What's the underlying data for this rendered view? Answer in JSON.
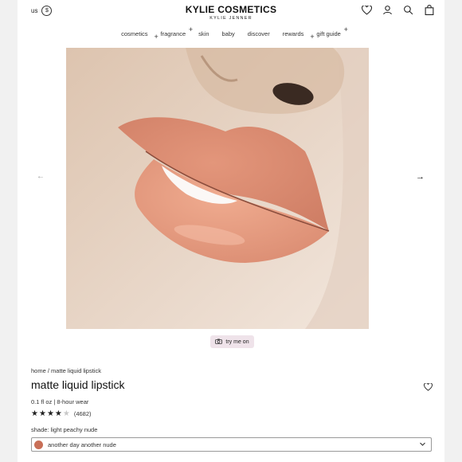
{
  "header": {
    "locale": "us",
    "currency_symbol": "$",
    "logo_main": "KYLIE COSMETICS",
    "logo_sub": "KYLIE JENNER",
    "icons": [
      "heart-icon",
      "account-icon",
      "search-icon",
      "bag-icon"
    ]
  },
  "nav": {
    "items": [
      "cosmetics",
      "fragrance",
      "skin",
      "baby",
      "discover",
      "rewards",
      "gift guide"
    ]
  },
  "hero": {
    "alt": "lip swatch close-up",
    "prev_icon": "arrow-left-icon",
    "next_icon": "arrow-right-icon"
  },
  "tryon": {
    "label": "try me on",
    "icon": "camera-icon"
  },
  "product": {
    "breadcrumb": [
      "home",
      "matte liquid lipstick"
    ],
    "title": "matte liquid lipstick",
    "subtitle": "0.1 fl oz | 8-hour wear",
    "rating": 4,
    "rating_max": 5,
    "rating_count": "(4682)",
    "shade_label": "shade: light peachy nude",
    "shade_selected": "another day another nude",
    "shade_color": "#c86f57"
  }
}
